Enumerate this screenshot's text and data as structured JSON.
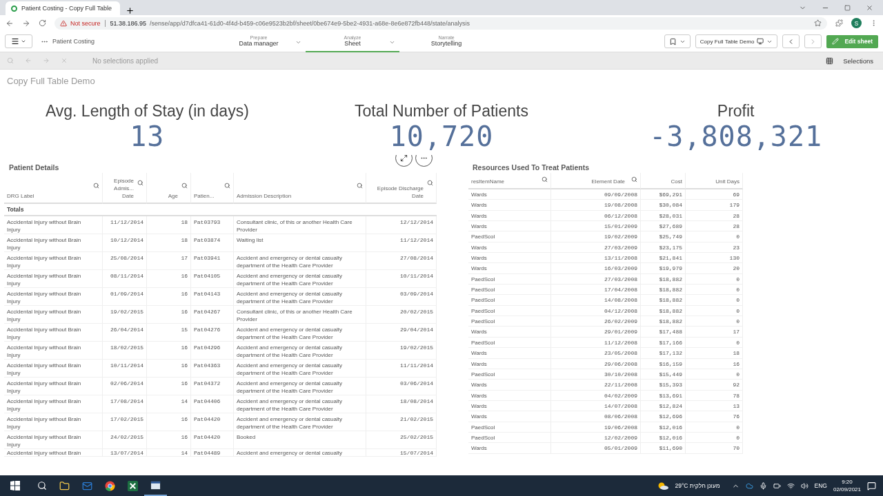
{
  "browser": {
    "tab_title": "Patient Costing - Copy Full Table",
    "security": "Not secure",
    "url_host": "51.38.186.95",
    "url_path": "/sense/app/d7dfca41-61d0-4f4d-b459-c06e9523b2bf/sheet/0be674e9-5be2-4931-a68e-8e6e872fb448/state/analysis",
    "profile": "S"
  },
  "app": {
    "name": "Patient Costing",
    "nav": [
      {
        "small": "Prepare",
        "label": "Data manager",
        "selected": false
      },
      {
        "small": "Analyze",
        "label": "Sheet",
        "selected": true
      },
      {
        "small": "Narrate",
        "label": "Storytelling",
        "selected": false
      }
    ],
    "sheet_name": "Copy Full Table Demo",
    "edit_button": "Edit sheet"
  },
  "selection_bar": {
    "text": "No selections applied",
    "selections": "Selections"
  },
  "sheet": {
    "title": "Copy Full Table Demo",
    "kpis": [
      {
        "title": "Avg. Length of Stay (in days)",
        "value": "13"
      },
      {
        "title": "Total Number of Patients",
        "value": "10,720"
      },
      {
        "title": "Profit",
        "value": "-3,808,321"
      }
    ],
    "patient_table": {
      "title": "Patient Details",
      "columns": [
        "DRG Label",
        "Episode Admis... Date",
        "Age",
        "Patien...",
        "Admission Description",
        "Episode Discharge Date"
      ],
      "totals_label": "Totals",
      "rows": [
        [
          "Accidental Injury without Brain Injury",
          "11/12/2014",
          "18",
          "Pat03793",
          "Consultant clinic, of this or another Health Care Provider",
          "12/12/2014"
        ],
        [
          "Accidental Injury without Brain Injury",
          "10/12/2014",
          "18",
          "Pat03874",
          "Waiting list",
          "11/12/2014"
        ],
        [
          "Accidental Injury without Brain Injury",
          "25/08/2014",
          "17",
          "Pat03941",
          "Accident and emergency or dental casualty department of the Health Care Provider",
          "27/08/2014"
        ],
        [
          "Accidental Injury without Brain Injury",
          "08/11/2014",
          "16",
          "Pat04105",
          "Accident and emergency or dental casualty department of the Health Care Provider",
          "10/11/2014"
        ],
        [
          "Accidental Injury without Brain Injury",
          "01/09/2014",
          "16",
          "Pat04143",
          "Accident and emergency or dental casualty department of the Health Care Provider",
          "03/09/2014"
        ],
        [
          "Accidental Injury without Brain Injury",
          "19/02/2015",
          "16",
          "Pat04267",
          "Consultant clinic, of this or another Health Care Provider",
          "20/02/2015"
        ],
        [
          "Accidental Injury without Brain Injury",
          "26/04/2014",
          "15",
          "Pat04276",
          "Accident and emergency or dental casualty department of the Health Care Provider",
          "29/04/2014"
        ],
        [
          "Accidental Injury without Brain Injury",
          "18/02/2015",
          "16",
          "Pat04296",
          "Accident and emergency or dental casualty department of the Health Care Provider",
          "19/02/2015"
        ],
        [
          "Accidental Injury without Brain Injury",
          "10/11/2014",
          "16",
          "Pat04363",
          "Accident and emergency or dental casualty department of the Health Care Provider",
          "11/11/2014"
        ],
        [
          "Accidental Injury without Brain Injury",
          "02/06/2014",
          "16",
          "Pat04372",
          "Accident and emergency or dental casualty department of the Health Care Provider",
          "03/06/2014"
        ],
        [
          "Accidental Injury without Brain Injury",
          "17/08/2014",
          "14",
          "Pat04406",
          "Accident and emergency or dental casualty department of the Health Care Provider",
          "18/08/2014"
        ],
        [
          "Accidental Injury without Brain Injury",
          "17/02/2015",
          "16",
          "Pat04420",
          "Accident and emergency or dental casualty department of the Health Care Provider",
          "21/02/2015"
        ],
        [
          "Accidental Injury without Brain Injury",
          "24/02/2015",
          "16",
          "Pat04420",
          "Booked",
          "25/02/2015"
        ],
        [
          "Accidental Injury without Brain",
          "13/07/2014",
          "14",
          "Pat04489",
          "Accident and emergency or dental casualty",
          "15/07/2014"
        ]
      ]
    },
    "resource_table": {
      "title": "Resources Used To Treat Patients",
      "columns": [
        "resItemName",
        "Element Date",
        "Cost",
        "Unit Days"
      ],
      "rows": [
        [
          "Wards",
          "09/09/2008",
          "$69,291",
          "69"
        ],
        [
          "Wards",
          "19/08/2008",
          "$30,084",
          "179"
        ],
        [
          "Wards",
          "06/12/2008",
          "$28,031",
          "28"
        ],
        [
          "Wards",
          "15/01/2009",
          "$27,689",
          "28"
        ],
        [
          "PaedScol",
          "19/02/2009",
          "$25,749",
          "0"
        ],
        [
          "Wards",
          "27/03/2009",
          "$23,175",
          "23"
        ],
        [
          "Wards",
          "13/11/2008",
          "$21,841",
          "130"
        ],
        [
          "Wards",
          "16/03/2009",
          "$19,979",
          "20"
        ],
        [
          "PaedScol",
          "27/03/2008",
          "$18,882",
          "0"
        ],
        [
          "PaedScol",
          "17/04/2008",
          "$18,882",
          "0"
        ],
        [
          "PaedScol",
          "14/08/2008",
          "$18,882",
          "0"
        ],
        [
          "PaedScol",
          "04/12/2008",
          "$18,882",
          "0"
        ],
        [
          "PaedScol",
          "26/02/2009",
          "$18,882",
          "0"
        ],
        [
          "Wards",
          "29/01/2009",
          "$17,488",
          "17"
        ],
        [
          "PaedScol",
          "11/12/2008",
          "$17,166",
          "0"
        ],
        [
          "Wards",
          "23/05/2008",
          "$17,132",
          "18"
        ],
        [
          "Wards",
          "29/06/2008",
          "$16,159",
          "16"
        ],
        [
          "PaedScol",
          "30/10/2008",
          "$15,449",
          "0"
        ],
        [
          "Wards",
          "22/11/2008",
          "$15,393",
          "92"
        ],
        [
          "Wards",
          "04/02/2009",
          "$13,691",
          "78"
        ],
        [
          "Wards",
          "14/07/2008",
          "$12,824",
          "13"
        ],
        [
          "Wards",
          "08/06/2008",
          "$12,696",
          "76"
        ],
        [
          "PaedScol",
          "19/06/2008",
          "$12,016",
          "0"
        ],
        [
          "PaedScol",
          "12/02/2009",
          "$12,016",
          "0"
        ],
        [
          "Wards",
          "05/01/2009",
          "$11,690",
          "70"
        ]
      ]
    }
  },
  "taskbar": {
    "weather": "29°C מעונן חלקית",
    "language": "ENG",
    "time": "9:20",
    "date": "02/09/2021"
  }
}
